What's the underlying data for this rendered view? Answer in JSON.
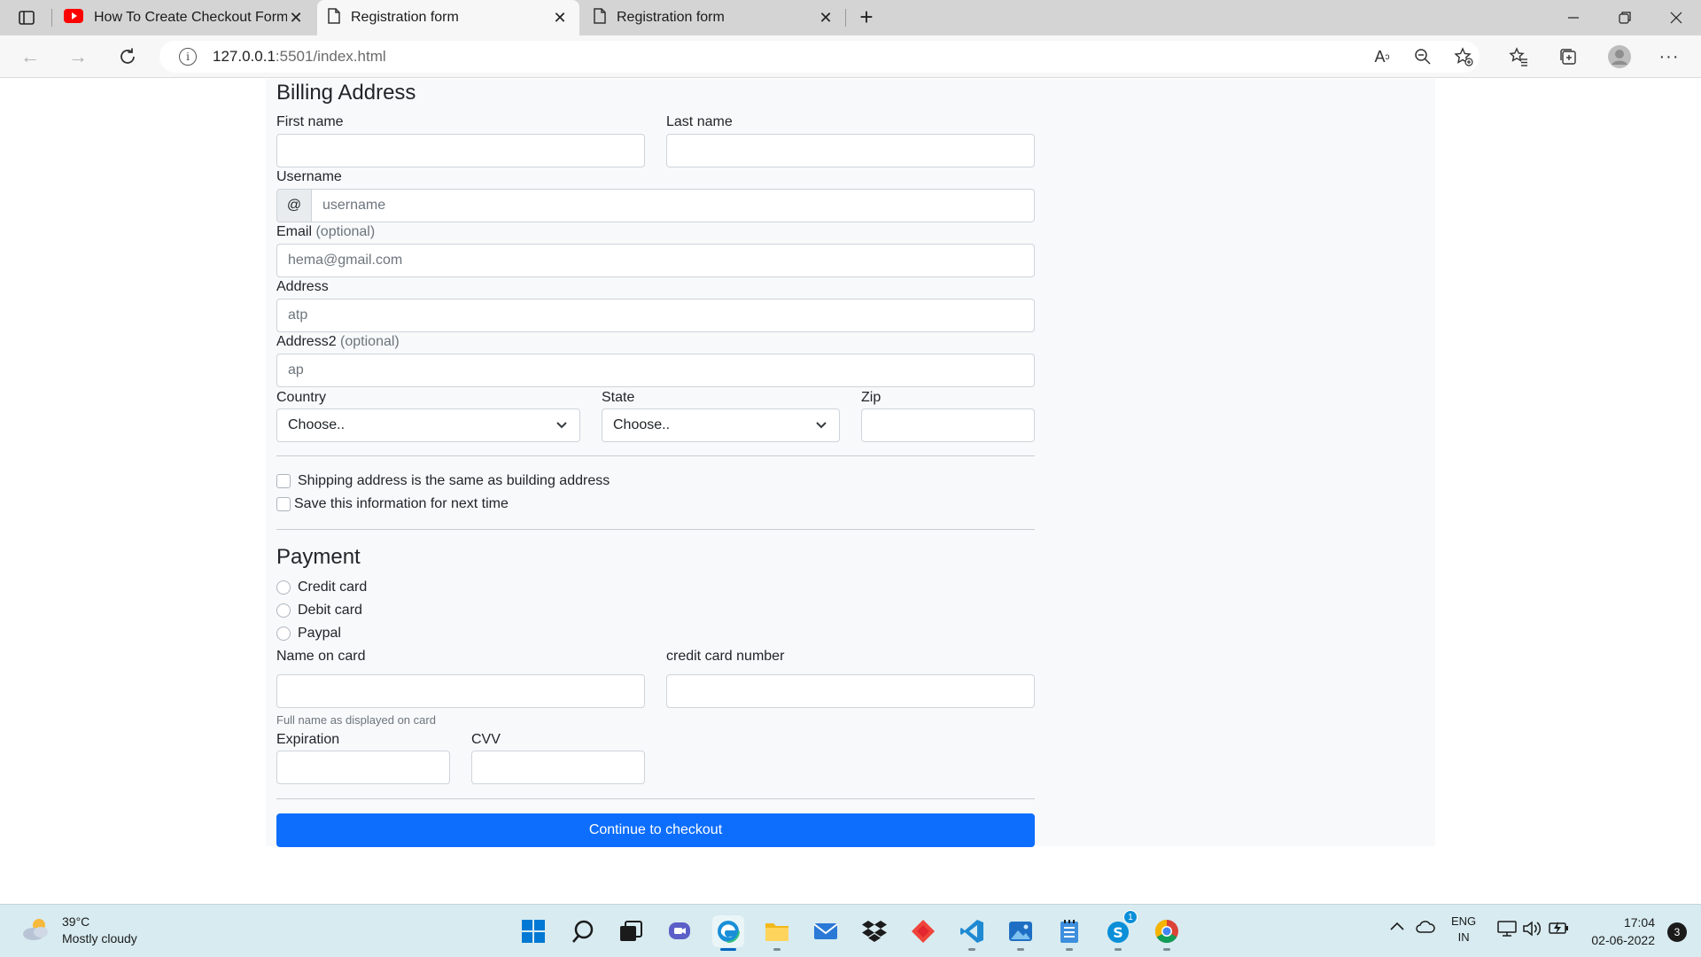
{
  "browser": {
    "tabs": [
      {
        "title": "How To Create Checkout Form u",
        "icon": "youtube-icon",
        "active": false
      },
      {
        "title": "Registration form",
        "icon": "page-icon",
        "active": true
      },
      {
        "title": "Registration form",
        "icon": "page-icon",
        "active": false
      }
    ],
    "url_host": "127.0.0.1",
    "url_rest": ":5501/index.html"
  },
  "billing": {
    "heading": "Billing Address",
    "first_name_label": "First name",
    "last_name_label": "Last name",
    "username_label": "Username",
    "username_prefix": "@",
    "username_placeholder": "username",
    "email_label": "Email",
    "email_optional": "(optional)",
    "email_placeholder": "hema@gmail.com",
    "address_label": "Address",
    "address_placeholder": "atp",
    "address2_label": "Address2",
    "address2_optional": "(optional)",
    "address2_placeholder": "ap",
    "country_label": "Country",
    "country_value": "Choose..",
    "state_label": "State",
    "state_value": "Choose..",
    "zip_label": "Zip",
    "same_address_label": "Shipping address is the same as building address",
    "save_info_label": "Save this information for next time"
  },
  "payment": {
    "heading": "Payment",
    "methods": [
      "Credit card",
      "Debit card",
      "Paypal"
    ],
    "name_on_card_label": "Name on card",
    "name_on_card_help": "Full name as displayed on card",
    "card_number_label": "credit card number",
    "expiration_label": "Expiration",
    "cvv_label": "CVV",
    "submit_label": "Continue to checkout"
  },
  "taskbar": {
    "temperature": "39°C",
    "weather": "Mostly cloudy",
    "lang_top": "ENG",
    "lang_bottom": "IN",
    "time": "17:04",
    "date": "02-06-2022",
    "notifications": "3",
    "skype_badge": "1"
  },
  "colors": {
    "primary": "#0d6efd",
    "panel": "#f8f9fa",
    "taskbar": "#d7ebf0"
  }
}
